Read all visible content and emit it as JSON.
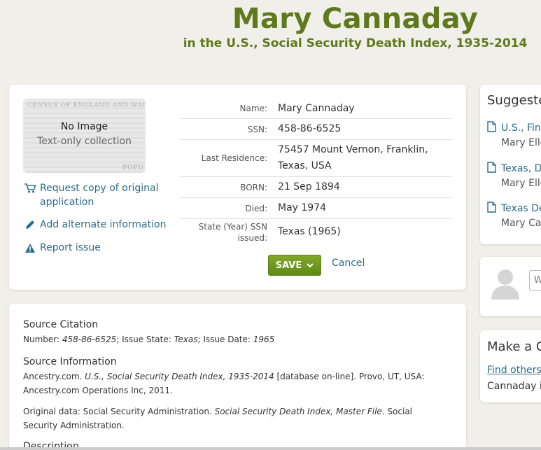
{
  "header": {
    "name": "Mary Cannaday",
    "collection": "in the U.S., Social Security Death Index, 1935-2014"
  },
  "record": {
    "thumbnail": {
      "census_text": "CENSUS OF ENGLAND AND WALES",
      "no_image": "No Image",
      "text_only": "Text-only collection",
      "popu": "POPU"
    },
    "actions": {
      "request_copy": "Request copy of original application",
      "add_alternate": "Add alternate information",
      "report_issue": "Report issue"
    },
    "facts": [
      {
        "label": "Name:",
        "value": "Mary Cannaday"
      },
      {
        "label": "SSN:",
        "value": "458-86-6525"
      },
      {
        "label": "Last Residence:",
        "value": "75457 Mount Vernon, Franklin, Texas, USA"
      },
      {
        "label": "BORN:",
        "value": "21 Sep 1894"
      },
      {
        "label": "Died:",
        "value": "May 1974"
      },
      {
        "label": "State (Year) SSN issued:",
        "value": "Texas (1965)"
      }
    ],
    "save_label": "SAVE",
    "cancel_label": "Cancel"
  },
  "source": {
    "citation_heading": "Source Citation",
    "citation_number_label": "Number: ",
    "citation_number": "458-86-6525",
    "citation_state_label": "; Issue State: ",
    "citation_state": "Texas",
    "citation_date_label": "; Issue Date: ",
    "citation_date": "1965",
    "info_heading": "Source Information",
    "info_prefix": "Ancestry.com. ",
    "info_title": "U.S., Social Security Death Index, 1935-2014",
    "info_suffix": " [database on-line]. Provo, UT, USA: Ancestry.com Operations Inc, 2011.",
    "orig_prefix": "Original data: Social Security Administration. ",
    "orig_title": "Social Security Death Index, Master File",
    "orig_suffix": ". Social Security Administration.",
    "description_heading": "Description"
  },
  "sidebar": {
    "suggested_heading": "Suggeste",
    "suggestions": [
      {
        "link": "U.S., Find",
        "person": "Mary Elle"
      },
      {
        "link": "Texas, D",
        "person": "Mary Elle"
      },
      {
        "link": "Texas De",
        "person": "Mary Car"
      }
    ],
    "profile_input_placeholder": "W",
    "connect_heading": "Make a Co",
    "connect_link": "Find others",
    "connect_text": "Cannaday in"
  },
  "colors": {
    "title_green": "#5e7a1c",
    "link_blue": "#2a6c8e",
    "save_green": "#6e9a1e",
    "background": "#f0efe9"
  }
}
